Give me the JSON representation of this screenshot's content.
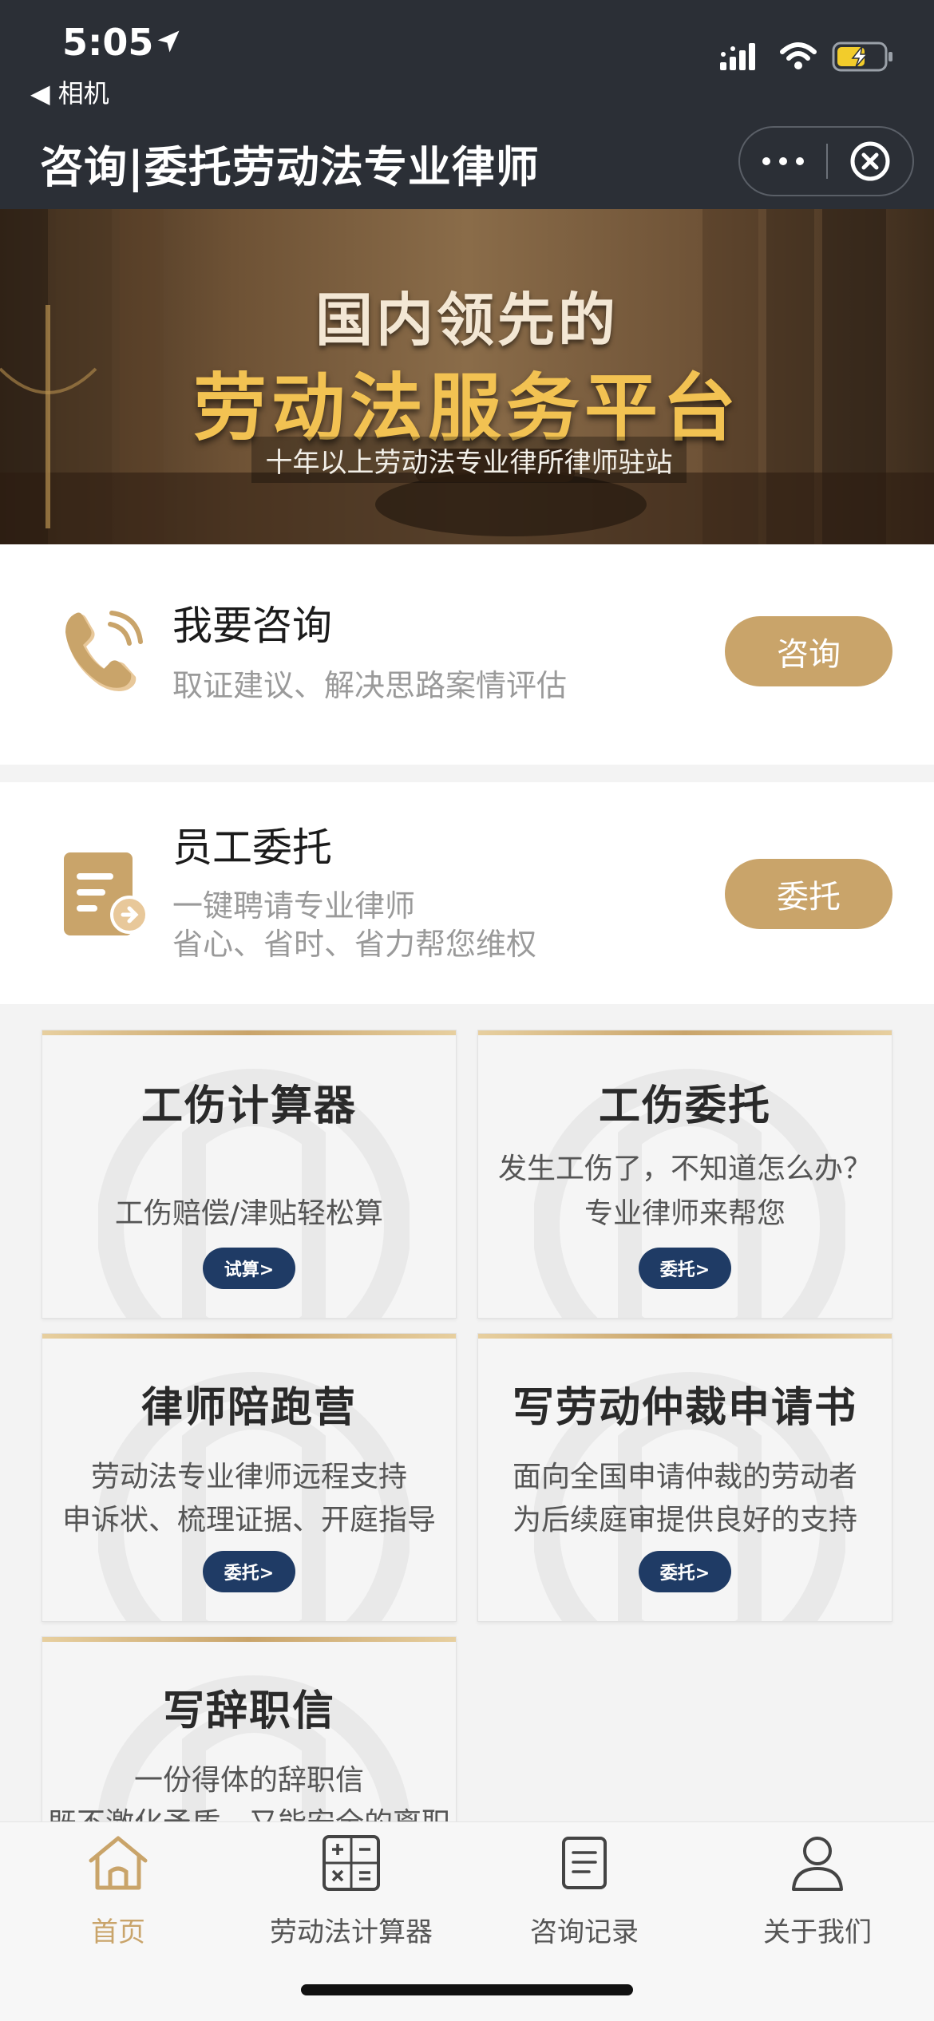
{
  "status_bar": {
    "time": "5:05",
    "back_app": "相机"
  },
  "header": {
    "title": "咨询|委托劳动法专业律师"
  },
  "banner": {
    "line1": "国内领先的",
    "line2": "劳动法服务平台",
    "line3": "十年以上劳动法专业律所律师驻站"
  },
  "actions": [
    {
      "title": "我要咨询",
      "lines": [
        "取证建议、解决思路案情评估"
      ],
      "button": "咨询",
      "icon": "phone-icon"
    },
    {
      "title": "员工委托",
      "lines": [
        "一键聘请专业律师",
        "省心、省时、省力帮您维权"
      ],
      "button": "委托",
      "icon": "document-icon"
    }
  ],
  "cards": [
    {
      "title": "工伤计算器",
      "lines": [
        "",
        "工伤赔偿/津贴轻松算"
      ],
      "button": "试算>"
    },
    {
      "title": "工伤委托",
      "lines": [
        "发生工伤了，不知道怎么办？",
        "专业律师来帮您"
      ],
      "button": "委托>"
    },
    {
      "title": "律师陪跑营",
      "lines": [
        "劳动法专业律师远程支持",
        "申诉状、梳理证据、开庭指导"
      ],
      "button": "委托>"
    },
    {
      "title": "写劳动仲裁申请书",
      "lines": [
        "面向全国申请仲裁的劳动者",
        "为后续庭审提供良好的支持"
      ],
      "button": "委托>"
    },
    {
      "title": "写辞职信",
      "lines": [
        "一份得体的辞职信",
        "既不激化矛盾，又能安全的离职"
      ],
      "button": ""
    }
  ],
  "tabbar": {
    "items": [
      {
        "label": "首页",
        "icon": "home-icon",
        "active": true
      },
      {
        "label": "劳动法计算器",
        "icon": "calculator-icon",
        "active": false
      },
      {
        "label": "咨询记录",
        "icon": "records-icon",
        "active": false
      },
      {
        "label": "关于我们",
        "icon": "user-icon",
        "active": false
      }
    ]
  },
  "colors": {
    "accent": "#c9a46a",
    "header_bg": "#2b2f36",
    "card_button": "#1f3b65"
  }
}
